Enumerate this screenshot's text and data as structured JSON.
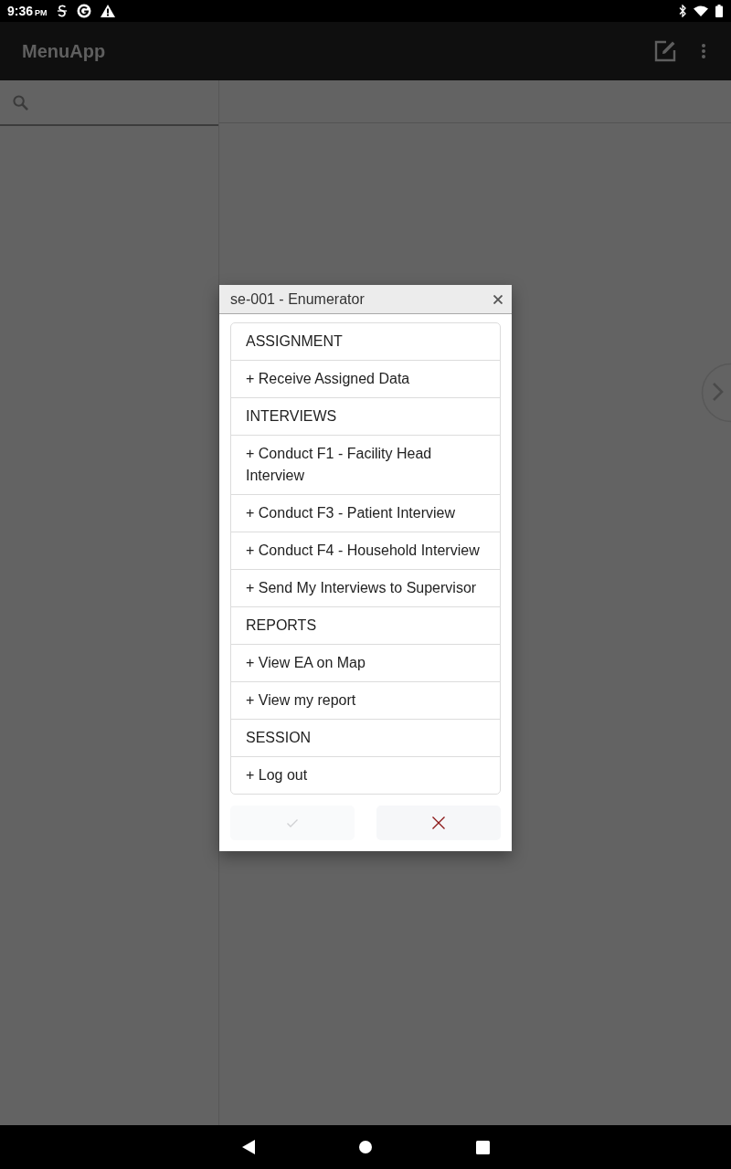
{
  "status_bar": {
    "time": "9:36",
    "meridiem": "PM"
  },
  "app_bar": {
    "title": "MenuApp"
  },
  "dialog": {
    "title": "se-001 - Enumerator",
    "items": [
      "ASSIGNMENT",
      "+ Receive Assigned Data",
      "INTERVIEWS",
      "+ Conduct F1 - Facility Head Interview",
      "+ Conduct F3 - Patient Interview",
      "+ Conduct F4 - Household Interview",
      "+ Send My Interviews to Supervisor",
      "REPORTS",
      "+ View EA on Map",
      "+ View my report",
      "SESSION",
      "+ Log out"
    ],
    "buttons": [
      {
        "kind": "confirm",
        "disabled": true
      },
      {
        "kind": "cancel",
        "disabled": false
      }
    ]
  }
}
